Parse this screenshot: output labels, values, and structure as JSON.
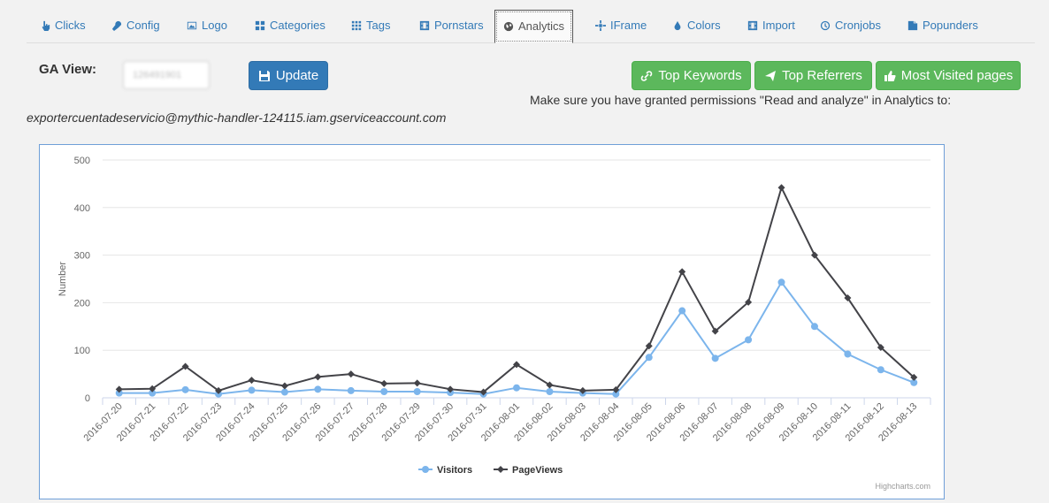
{
  "tabs": [
    {
      "label": "Clicks",
      "icon": "hand-pointer-icon",
      "active": false
    },
    {
      "label": "Config",
      "icon": "wrench-icon",
      "active": false
    },
    {
      "label": "Logo",
      "icon": "image-icon",
      "active": false
    },
    {
      "label": "Categories",
      "icon": "th-large-icon",
      "active": false
    },
    {
      "label": "Tags",
      "icon": "th-icon",
      "active": false
    },
    {
      "label": "Pornstars",
      "icon": "film-icon",
      "active": false
    },
    {
      "label": "Analytics",
      "icon": "globe-icon",
      "active": true
    },
    {
      "label": "IFrame",
      "icon": "crosshair-icon",
      "active": false
    },
    {
      "label": "Colors",
      "icon": "tint-icon",
      "active": false
    },
    {
      "label": "Import",
      "icon": "film-icon",
      "active": false
    },
    {
      "label": "Cronjobs",
      "icon": "clock-icon",
      "active": false
    },
    {
      "label": "Popunders",
      "icon": "files-icon",
      "active": false
    }
  ],
  "ga": {
    "label": "GA View:",
    "input_value": "126491901",
    "update_label": "Update"
  },
  "actions": {
    "top_keywords": "Top Keywords",
    "top_referrers": "Top Referrers",
    "most_visited": "Most Visited pages"
  },
  "permission_note": "Make sure you have granted permissions \"Read and analyze\" in Analytics to:",
  "service_account": "exportercuentadeservicio@mythic-handler-124115.iam.gserviceaccount.com",
  "colors": {
    "visitors": "#7cb5ec",
    "pageviews": "#434348",
    "primary": "#337ab7",
    "success": "#5cb85c"
  },
  "chart_data": {
    "type": "line",
    "ylabel": "Number",
    "ylim": [
      0,
      500
    ],
    "yticks": [
      0,
      100,
      200,
      300,
      400,
      500
    ],
    "grid": true,
    "legend_position": "bottom-center",
    "credit": "Highcharts.com",
    "categories": [
      "2016-07-20",
      "2016-07-21",
      "2016-07-22",
      "2016-07-23",
      "2016-07-24",
      "2016-07-25",
      "2016-07-26",
      "2016-07-27",
      "2016-07-28",
      "2016-07-29",
      "2016-07-30",
      "2016-07-31",
      "2016-08-01",
      "2016-08-02",
      "2016-08-03",
      "2016-08-04",
      "2016-08-05",
      "2016-08-06",
      "2016-08-07",
      "2016-08-08",
      "2016-08-09",
      "2016-08-10",
      "2016-08-11",
      "2016-08-12",
      "2016-08-13"
    ],
    "series": [
      {
        "name": "Visitors",
        "values": [
          10,
          10,
          17,
          8,
          16,
          12,
          18,
          15,
          13,
          13,
          11,
          8,
          21,
          13,
          10,
          8,
          85,
          183,
          83,
          122,
          243,
          150,
          92,
          59,
          32
        ]
      },
      {
        "name": "PageViews",
        "values": [
          18,
          19,
          66,
          15,
          37,
          25,
          44,
          50,
          30,
          31,
          18,
          12,
          70,
          27,
          15,
          17,
          109,
          265,
          140,
          201,
          442,
          300,
          210,
          106,
          43
        ]
      }
    ]
  }
}
